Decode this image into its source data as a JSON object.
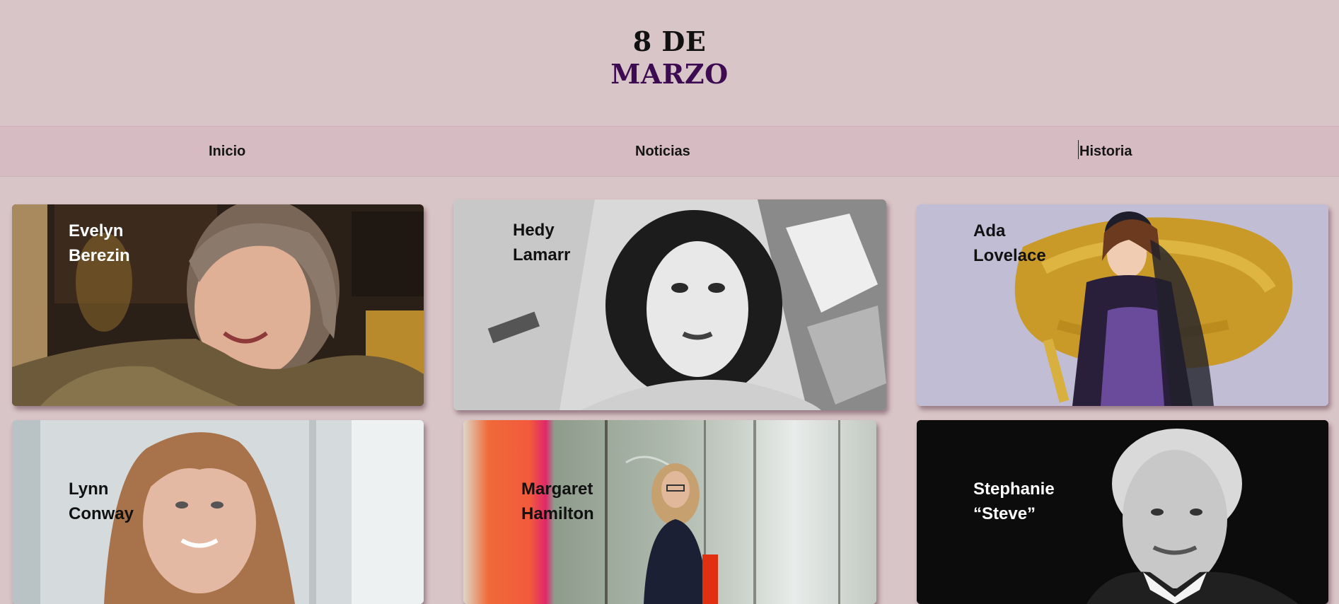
{
  "header": {
    "title_line1": "8 DE",
    "title_line2": "MARZO"
  },
  "nav": {
    "items": [
      {
        "label": "Inicio"
      },
      {
        "label": "Noticias"
      },
      {
        "label": "Historia"
      }
    ]
  },
  "cards": [
    {
      "line1": "Evelyn",
      "line2": "Berezin"
    },
    {
      "line1": "Hedy",
      "line2": "Lamarr"
    },
    {
      "line1": "Ada",
      "line2": "Lovelace"
    },
    {
      "line1": "Lynn",
      "line2": "Conway"
    },
    {
      "line1": "Margaret",
      "line2": "Hamilton"
    },
    {
      "line1": "Stephanie",
      "line2": "“Steve”"
    }
  ],
  "colors": {
    "background": "#d8c5c7",
    "nav": "#d6bbc3",
    "title_accent": "#3d0b52"
  }
}
